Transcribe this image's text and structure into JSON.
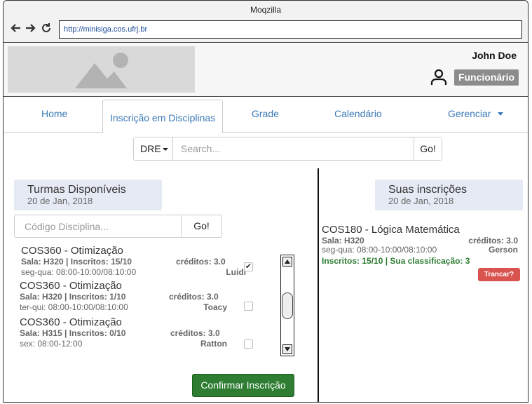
{
  "window": {
    "title": "Moqzilla"
  },
  "browser": {
    "url": "http://minisiga.cos.ufrj.br"
  },
  "header": {
    "user_name": "John Doe",
    "role_badge": "Funcionário"
  },
  "tabs": [
    {
      "label": "Home"
    },
    {
      "label": "Inscrição em Disciplinas",
      "active": true
    },
    {
      "label": "Grade"
    },
    {
      "label": "Calendário"
    },
    {
      "label": "Gerenciar"
    }
  ],
  "search": {
    "type_label": "DRE",
    "placeholder": "Search...",
    "go_label": "Go!"
  },
  "available": {
    "title": "Turmas Disponíveis",
    "date": "20 de Jan, 2018",
    "code_placeholder": "Código Disciplina...",
    "code_go_label": "Go!",
    "courses": [
      {
        "name": "COS360 - Otimização",
        "details": "Sala: H320 | Inscritos: 15/10",
        "credits": "créditos: 3.0",
        "schedule": "seg-qua: 08:00-10:00/08:10:00",
        "professor": "Luidi",
        "checked": true
      },
      {
        "name": "COS360 - Otimização",
        "details": "Sala: H320 |  Inscritos: 1/10",
        "credits": "créditos: 3.0",
        "schedule": "ter-qui: 08:00-10:00/08:10:00",
        "professor": "Toacy",
        "checked": false
      },
      {
        "name": "COS360 - Otimização",
        "details": "Sala: H315 |  Inscritos: 0/10",
        "credits": "créditos: 3.0",
        "schedule": "sex: 08:00-12:00",
        "professor": "Ratton",
        "checked": false
      }
    ],
    "confirm_label": "Confirmar Inscrição"
  },
  "enrolled": {
    "title": "Suas inscrições",
    "date": "20 de Jan, 2018",
    "items": [
      {
        "name": "COS180 - Lógica Matemática",
        "details": "Sala: H320",
        "credits": "créditos: 3.0",
        "schedule": "seg-qua: 08:00-10:00/08:10:00",
        "professor": "Gerson",
        "status": "Inscritos: 15/10 | Sua classificação: 3",
        "drop_label": "Trancar?"
      }
    ]
  },
  "colors": {
    "accent": "#3a7ab8",
    "confirm": "#2e7d32",
    "danger": "#d9534f",
    "badge": "#8c8c8c",
    "section_bg": "#e6eaf4"
  },
  "icons": [
    "back-arrow-icon",
    "forward-arrow-icon",
    "reload-icon",
    "image-placeholder-icon",
    "user-icon",
    "caret-down-icon",
    "checkbox-checked-icon"
  ]
}
